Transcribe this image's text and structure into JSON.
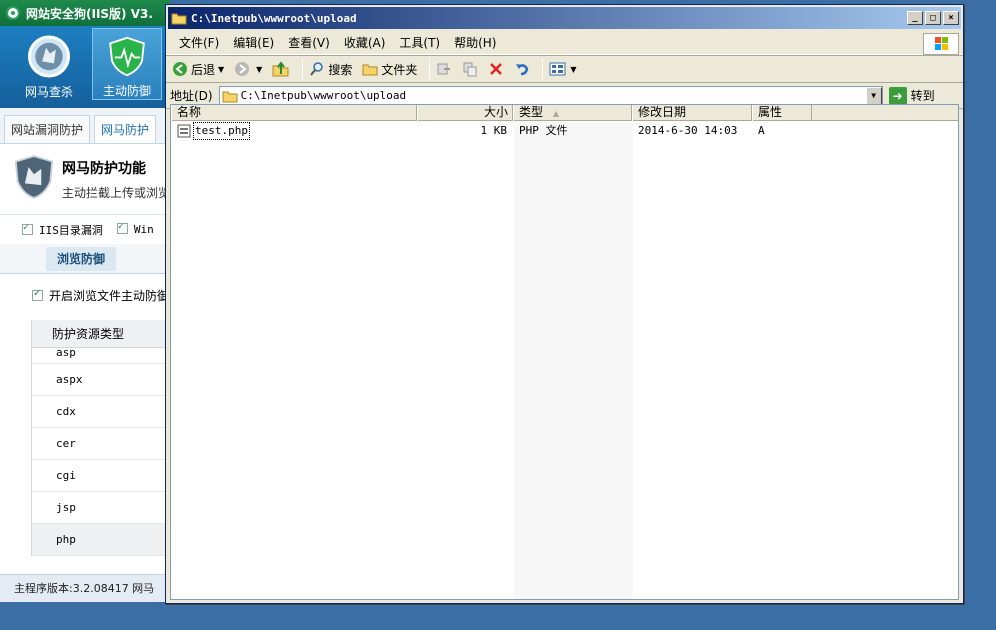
{
  "safedog": {
    "title": "网站安全狗(IIS版) V3.",
    "tools": [
      {
        "label": "网马查杀"
      },
      {
        "label": "主动防御"
      }
    ],
    "tabs": [
      "网站漏洞防护",
      "网马防护"
    ],
    "header": {
      "title": "网马防护功能",
      "desc": "主动拦截上传或浏览"
    },
    "checks": [
      "IIS目录漏洞",
      "Win"
    ],
    "subtab": "浏览防御",
    "enable_label": "开启浏览文件主动防御",
    "table": {
      "header": "防护资源类型",
      "rows": [
        "asp",
        "aspx",
        "cdx",
        "cer",
        "cgi",
        "jsp",
        "php"
      ]
    },
    "status": "主程序版本:3.2.08417   网马"
  },
  "explorer": {
    "title": "C:\\Inetpub\\wwwroot\\upload",
    "menu": [
      "文件(F)",
      "编辑(E)",
      "查看(V)",
      "收藏(A)",
      "工具(T)",
      "帮助(H)"
    ],
    "toolbar": {
      "back": "后退",
      "search": "搜索",
      "folders": "文件夹"
    },
    "address": {
      "label": "地址(D)",
      "value": "C:\\Inetpub\\wwwroot\\upload",
      "go": "转到"
    },
    "columns": {
      "name": "名称",
      "size": "大小",
      "type": "类型",
      "modified": "修改日期",
      "attributes": "属性"
    },
    "files": [
      {
        "name": "test.php",
        "size": "1 KB",
        "type": "PHP 文件",
        "modified": "2014-6-30 14:03",
        "attributes": "A"
      }
    ]
  },
  "colors": {
    "desktop": "#3a6ea5",
    "titlebar_start": "#0a246a",
    "titlebar_end": "#a6caf0",
    "safedog_green": "#1f8a4c",
    "safedog_blue": "#1d7fc0"
  }
}
